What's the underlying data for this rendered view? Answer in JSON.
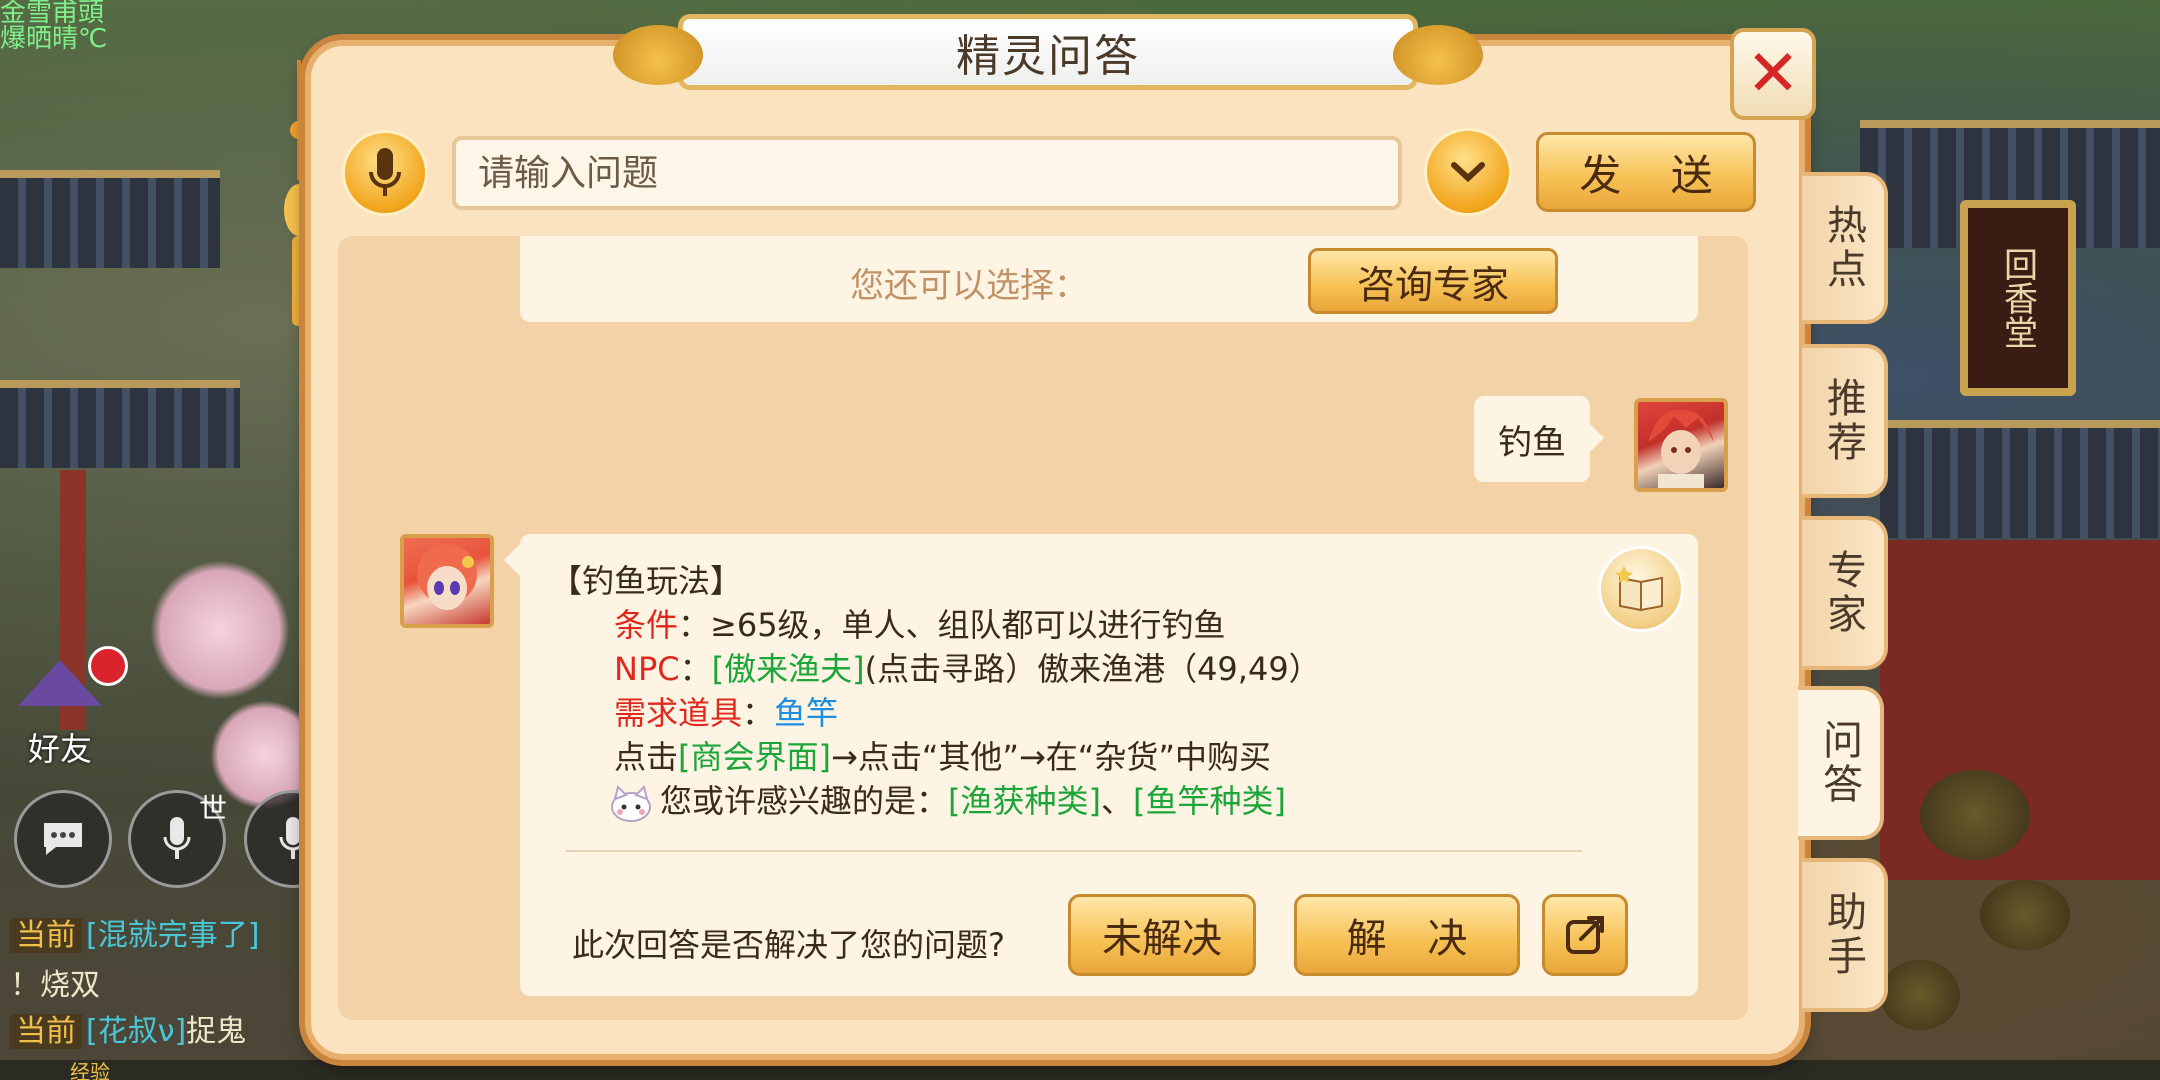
{
  "hud": {
    "top_left_line1": "金雪甫頭",
    "top_left_line2": "爆晒晴℃",
    "friends_label": "好友",
    "world_label": "世",
    "chat": [
      {
        "tag": "当前",
        "text": "[混就完事了]",
        "suffix": ""
      },
      {
        "tag": "",
        "text": "！烧双",
        "suffix": ""
      },
      {
        "tag": "当前",
        "text": "[花叔ν]",
        "suffix": "捉鬼"
      }
    ],
    "exp_label": "经验"
  },
  "scene": {
    "shop_sign": "回香堂"
  },
  "dialog": {
    "title": "精灵问答",
    "input_placeholder": "请输入问题",
    "send_label": "发 送",
    "tabs": [
      {
        "label": "热点",
        "active": false
      },
      {
        "label": "推荐",
        "active": false
      },
      {
        "label": "专家",
        "active": false
      },
      {
        "label": "问答",
        "active": true
      },
      {
        "label": "助手",
        "active": false
      }
    ],
    "conversation": {
      "prev_choice_label": "您还可以选择：",
      "expert_button": "咨询专家",
      "user_message": "钓鱼",
      "answer": {
        "heading": "【钓鱼玩法】",
        "cond_label": "条件",
        "cond_text": "：≥65级，单人、组队都可以进行钓鱼",
        "npc_label": "NPC",
        "npc_colon": "：",
        "npc_link": "[傲来渔夫]",
        "npc_rest": "(点击寻路）傲来渔港（49,49）",
        "item_label": "需求道具",
        "item_colon": "：",
        "item_value": "鱼竿",
        "buy_prefix": "点击",
        "buy_link": "[商会界面]",
        "buy_rest": "→点击“其他”→在“杂货”中购买",
        "interest_prefix": "您或许感兴趣的是：",
        "interest_link1": "[渔获种类]",
        "interest_sep": "、",
        "interest_link2": "[鱼竿种类]"
      },
      "feedback_question": "此次回答是否解决了您的问题?",
      "unresolved_label": "未解决",
      "resolved_label": "解 决"
    }
  },
  "colors": {
    "accent": "#f6c053",
    "link_green": "#1ca63a",
    "label_red": "#e0281e",
    "item_blue": "#1e8ee0"
  }
}
